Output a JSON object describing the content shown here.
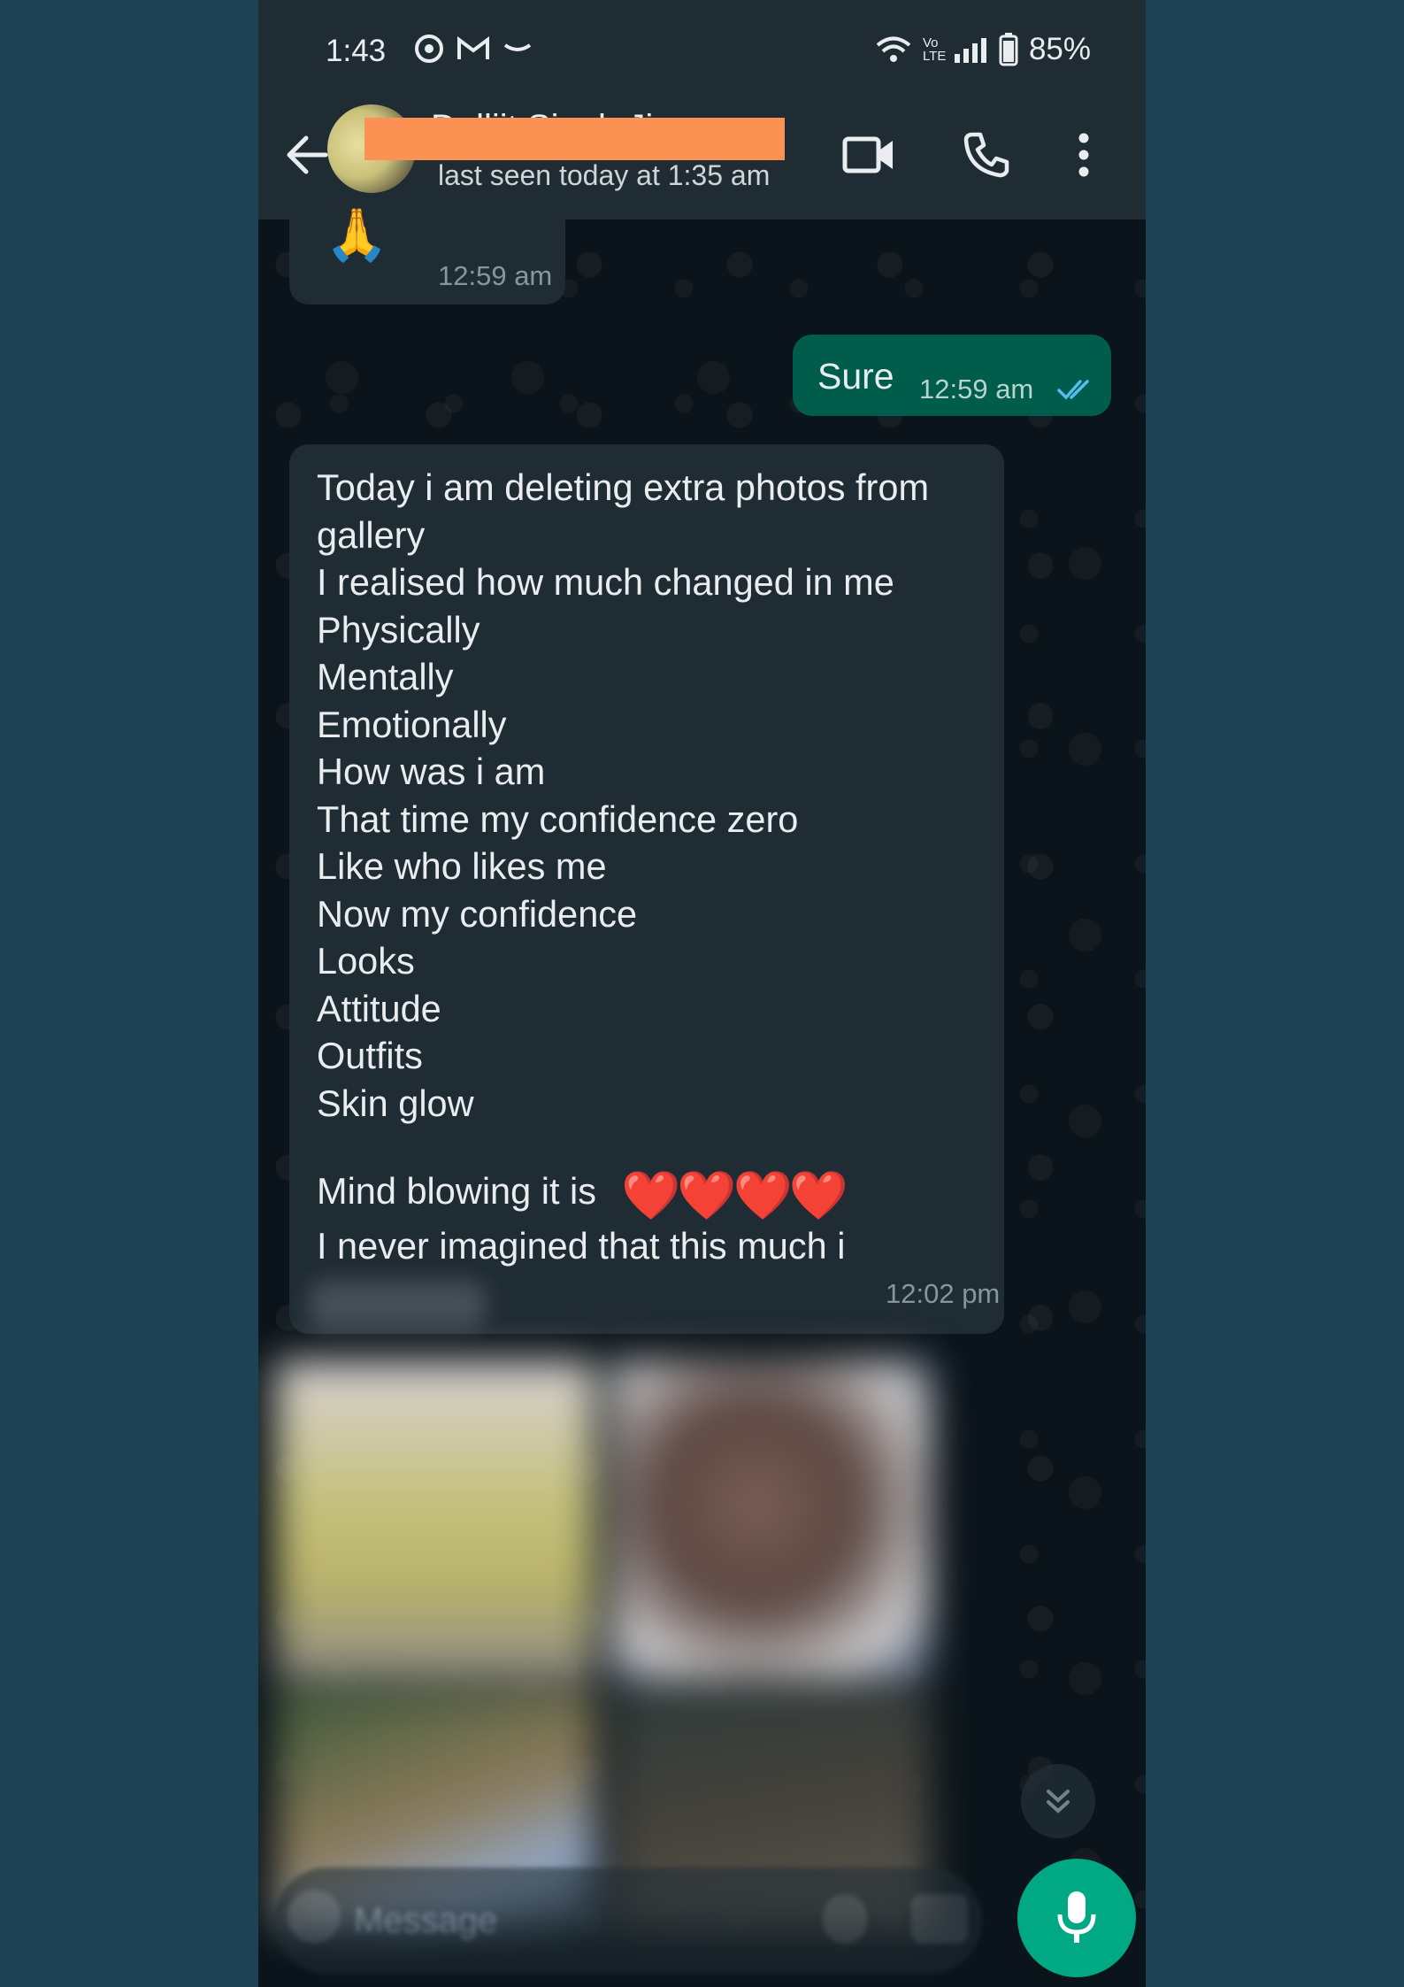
{
  "status_bar": {
    "time": "1:43",
    "battery": "85%",
    "network_label": "Vo LTE"
  },
  "header": {
    "contact_name": "Dalljit Singh Ji",
    "last_seen": "last seen today at 1:35 am"
  },
  "messages": {
    "m1": {
      "emoji": "🙏",
      "time": "12:59 am"
    },
    "m2": {
      "text": "Sure",
      "time": "12:59 am"
    },
    "m3": {
      "lines": [
        "Today i am deleting extra photos from",
        "gallery",
        "I realised how much changed in me",
        "Physically",
        "Mentally",
        "Emotionally",
        "How was i am",
        "That time my confidence zero",
        "Like who likes me",
        "Now my confidence",
        "Looks",
        "Attitude",
        "Outfits",
        "Skin glow",
        "",
        "Mind blowing it is",
        "I never imagined that this much i"
      ],
      "hearts": "❤️❤️❤️❤️",
      "time": "12:02 pm"
    }
  },
  "composer": {
    "placeholder": "Message"
  },
  "colors": {
    "app_bar": "#1f2c34",
    "chat_bg": "#0b141a",
    "incoming_bubble": "#202c33",
    "outgoing_bubble": "#005c4b",
    "accent": "#00a884",
    "redaction": "#fb9153"
  }
}
